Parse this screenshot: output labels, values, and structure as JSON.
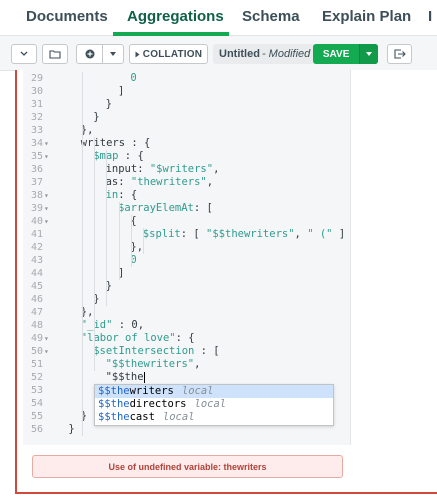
{
  "tabs": [
    {
      "label": "Documents"
    },
    {
      "label": "Aggregations"
    },
    {
      "label": "Schema"
    },
    {
      "label": "Explain Plan"
    },
    {
      "label": "I"
    }
  ],
  "toolbar": {
    "collation_label": "COLLATION",
    "doc_name": "Untitled",
    "doc_status": "- Modified",
    "save_label": "SAVE"
  },
  "editor": {
    "lines": [
      {
        "n": "29",
        "fold": "",
        "indent": 6,
        "text": "0"
      },
      {
        "n": "30",
        "fold": "",
        "indent": 5,
        "text": "]"
      },
      {
        "n": "31",
        "fold": "",
        "indent": 4,
        "text": "}"
      },
      {
        "n": "32",
        "fold": "",
        "indent": 3,
        "text": "}"
      },
      {
        "n": "33",
        "fold": "",
        "indent": 2,
        "text": "},"
      },
      {
        "n": "34",
        "fold": "▾",
        "indent": 2,
        "text": "writers : {"
      },
      {
        "n": "35",
        "fold": "▾",
        "indent": 3,
        "text": "$map : {"
      },
      {
        "n": "36",
        "fold": "",
        "indent": 4,
        "text": "input: \"$writers\","
      },
      {
        "n": "37",
        "fold": "",
        "indent": 4,
        "text": "as: \"thewriters\","
      },
      {
        "n": "38",
        "fold": "▾",
        "indent": 4,
        "text": "in: {"
      },
      {
        "n": "39",
        "fold": "▾",
        "indent": 5,
        "text": "$arrayElemAt: ["
      },
      {
        "n": "40",
        "fold": "▾",
        "indent": 6,
        "text": "{"
      },
      {
        "n": "41",
        "fold": "",
        "indent": 7,
        "text": "$split: [ \"$$thewriters\", \" (\" ]"
      },
      {
        "n": "42",
        "fold": "",
        "indent": 6,
        "text": "},"
      },
      {
        "n": "43",
        "fold": "",
        "indent": 6,
        "text": "0"
      },
      {
        "n": "44",
        "fold": "",
        "indent": 5,
        "text": "]"
      },
      {
        "n": "45",
        "fold": "",
        "indent": 4,
        "text": "}"
      },
      {
        "n": "46",
        "fold": "",
        "indent": 3,
        "text": "}"
      },
      {
        "n": "47",
        "fold": "",
        "indent": 2,
        "text": "},"
      },
      {
        "n": "48",
        "fold": "",
        "indent": 2,
        "text": "\"_id\" : 0,"
      },
      {
        "n": "49",
        "fold": "▾",
        "indent": 2,
        "text": "\"labor of love\": {"
      },
      {
        "n": "50",
        "fold": "▾",
        "indent": 3,
        "text": "$setIntersection : ["
      },
      {
        "n": "51",
        "fold": "",
        "indent": 4,
        "text": "\"$$thewriters\","
      },
      {
        "n": "52",
        "fold": "",
        "indent": 4,
        "text": "\"$$the"
      },
      {
        "n": "53",
        "fold": "",
        "indent": 3,
        "text": ""
      },
      {
        "n": "54",
        "fold": "",
        "indent": 3,
        "text": "]"
      },
      {
        "n": "55",
        "fold": "",
        "indent": 2,
        "text": "}"
      },
      {
        "n": "56",
        "fold": "",
        "indent": 1,
        "text": "}"
      }
    ]
  },
  "autocomplete": {
    "items": [
      {
        "match": "$$the",
        "rest": "writers",
        "meta": "local",
        "selected": true
      },
      {
        "match": "$$the",
        "rest": "directors",
        "meta": "local",
        "selected": false
      },
      {
        "match": "$$the",
        "rest": "cast",
        "meta": "local",
        "selected": false
      }
    ]
  },
  "error": {
    "message": "Use of undefined variable: thewriters"
  },
  "colors": {
    "accent": "#13aa52",
    "error_border": "#cf4a3c",
    "syntax_string": "#2e9c8f"
  }
}
